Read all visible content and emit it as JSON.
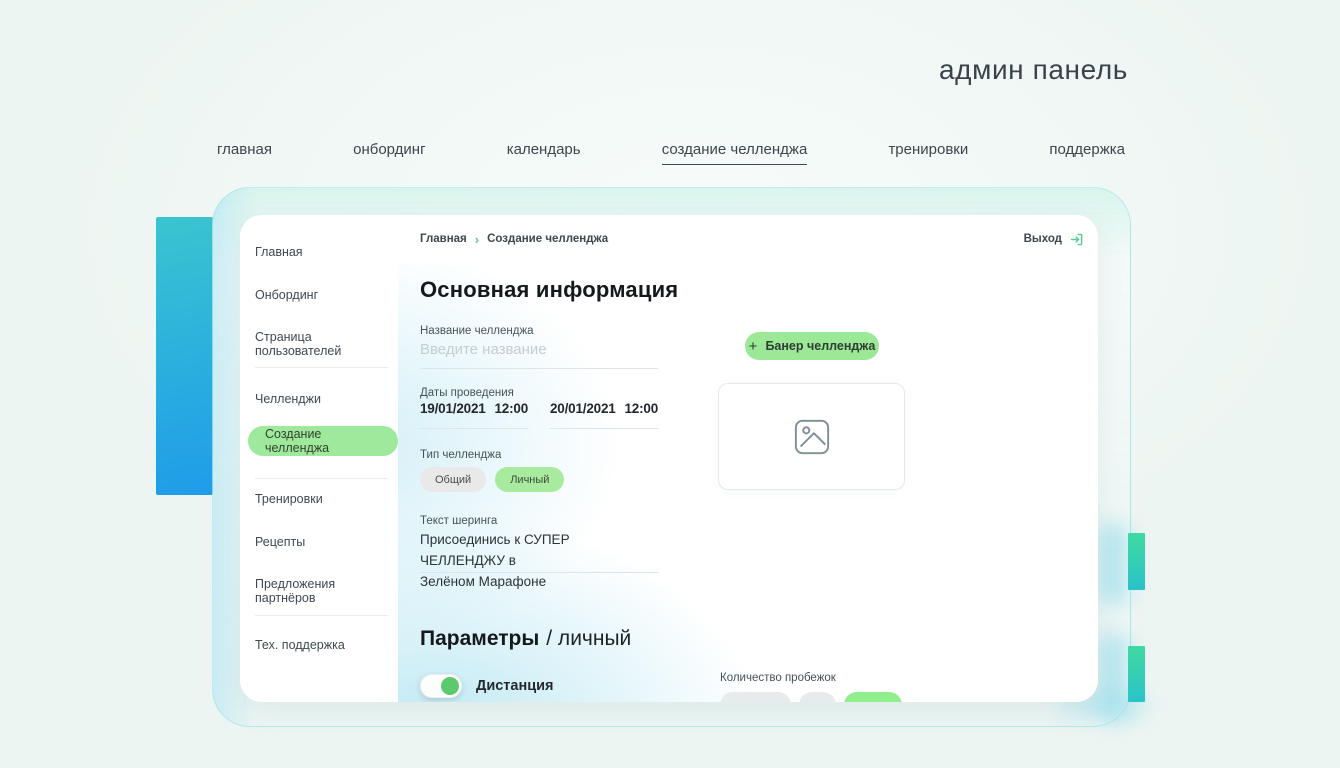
{
  "page": {
    "title": "админ панель"
  },
  "nav": {
    "items": [
      {
        "label": "главная",
        "active": false
      },
      {
        "label": "онбординг",
        "active": false
      },
      {
        "label": "календарь",
        "active": false
      },
      {
        "label": "создание челленджа",
        "active": true
      },
      {
        "label": "тренировки",
        "active": false
      },
      {
        "label": "поддержка",
        "active": false
      }
    ]
  },
  "sidebar": {
    "items": [
      {
        "label": "Главная"
      },
      {
        "label": "Онбординг"
      },
      {
        "label": "Страница пользователей"
      },
      {
        "label": "Челленджи"
      },
      {
        "label": "Создание челленджа",
        "active": true
      },
      {
        "label": "Тренировки"
      },
      {
        "label": "Рецепты"
      },
      {
        "label": "Предложения партнёров"
      },
      {
        "label": "Тех. поддержка"
      }
    ]
  },
  "topbar": {
    "breadcrumb": {
      "items": [
        "Главная",
        "Создание челленджа"
      ],
      "separator": "›"
    },
    "logout_label": "Выход"
  },
  "main": {
    "section_title": "Основная информация",
    "name_field": {
      "label": "Название челленджа",
      "placeholder": "Введите название",
      "value": ""
    },
    "dates_field": {
      "label": "Даты проведения",
      "start_date": "19/01/2021",
      "start_time": "12:00",
      "end_date": "20/01/2021",
      "end_time": "12:00"
    },
    "type_field": {
      "label": "Тип челленджа",
      "options": [
        {
          "label": "Общий",
          "selected": false
        },
        {
          "label": "Личный",
          "selected": true
        }
      ]
    },
    "sharing_field": {
      "label": "Текст шеринга",
      "value": "Присоединись к СУПЕР ЧЕЛЛЕНДЖУ в\nЗелёном Марафоне"
    },
    "banner_button": {
      "plus": "+",
      "label": "Банер челленджа"
    },
    "params": {
      "title_bold": "Параметры",
      "title_rest": "/ личный",
      "distance": {
        "label": "Дистанция",
        "enabled": true
      },
      "runs_count": {
        "label": "Количество пробежок",
        "chips": [
          {
            "style": "gray"
          },
          {
            "style": "gray"
          },
          {
            "style": "green"
          }
        ]
      }
    }
  },
  "colors": {
    "accent_green": "#9fe99c",
    "accent_green_bright": "#8eef8c",
    "toggle_green": "#5cc96d",
    "link_green": "#50cf8d",
    "chip_gray": "#e9e9ea",
    "left_bar_gradient_top": "#3bc4d0",
    "left_bar_gradient_bottom": "#1f9ce9",
    "right_bar_gradient_top": "#3fd9a2",
    "right_bar_gradient_bottom": "#2ac3c8"
  }
}
